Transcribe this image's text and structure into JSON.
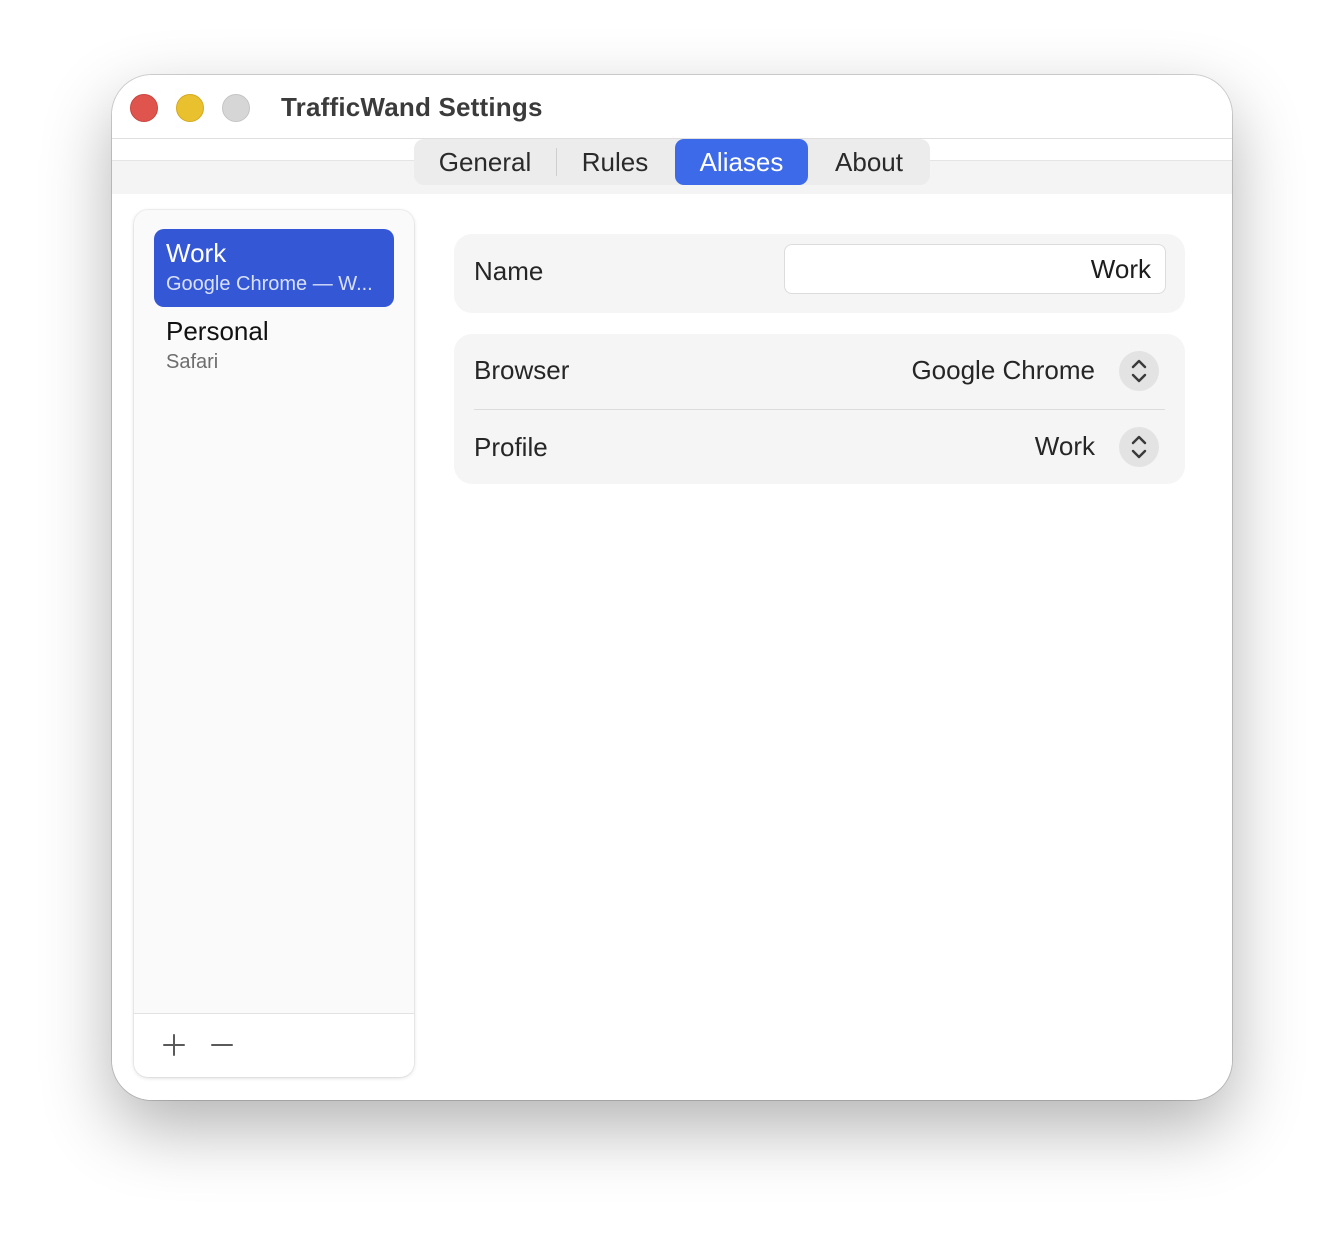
{
  "window": {
    "title": "TrafficWand Settings"
  },
  "tabs": [
    {
      "label": "General",
      "active": false
    },
    {
      "label": "Rules",
      "active": false
    },
    {
      "label": "Aliases",
      "active": true
    },
    {
      "label": "About",
      "active": false
    }
  ],
  "aliases": [
    {
      "name": "Work",
      "subtitle": "Google Chrome — W...",
      "selected": true
    },
    {
      "name": "Personal",
      "subtitle": "Safari",
      "selected": false
    }
  ],
  "sidebar_footer": {
    "add_label": "+",
    "remove_label": "—"
  },
  "detail": {
    "name_label": "Name",
    "name_value": "Work",
    "browser_label": "Browser",
    "browser_value": "Google Chrome",
    "profile_label": "Profile",
    "profile_value": "Work"
  },
  "colors": {
    "accent": "#3d6ae8",
    "selection": "#3457d5",
    "close": "#e0544e",
    "minimize": "#e9c02e",
    "zoom": "#d6d6d6"
  },
  "icons": {
    "stepper": "chevron-up-down-icon",
    "add": "plus-icon",
    "remove": "minus-icon"
  }
}
